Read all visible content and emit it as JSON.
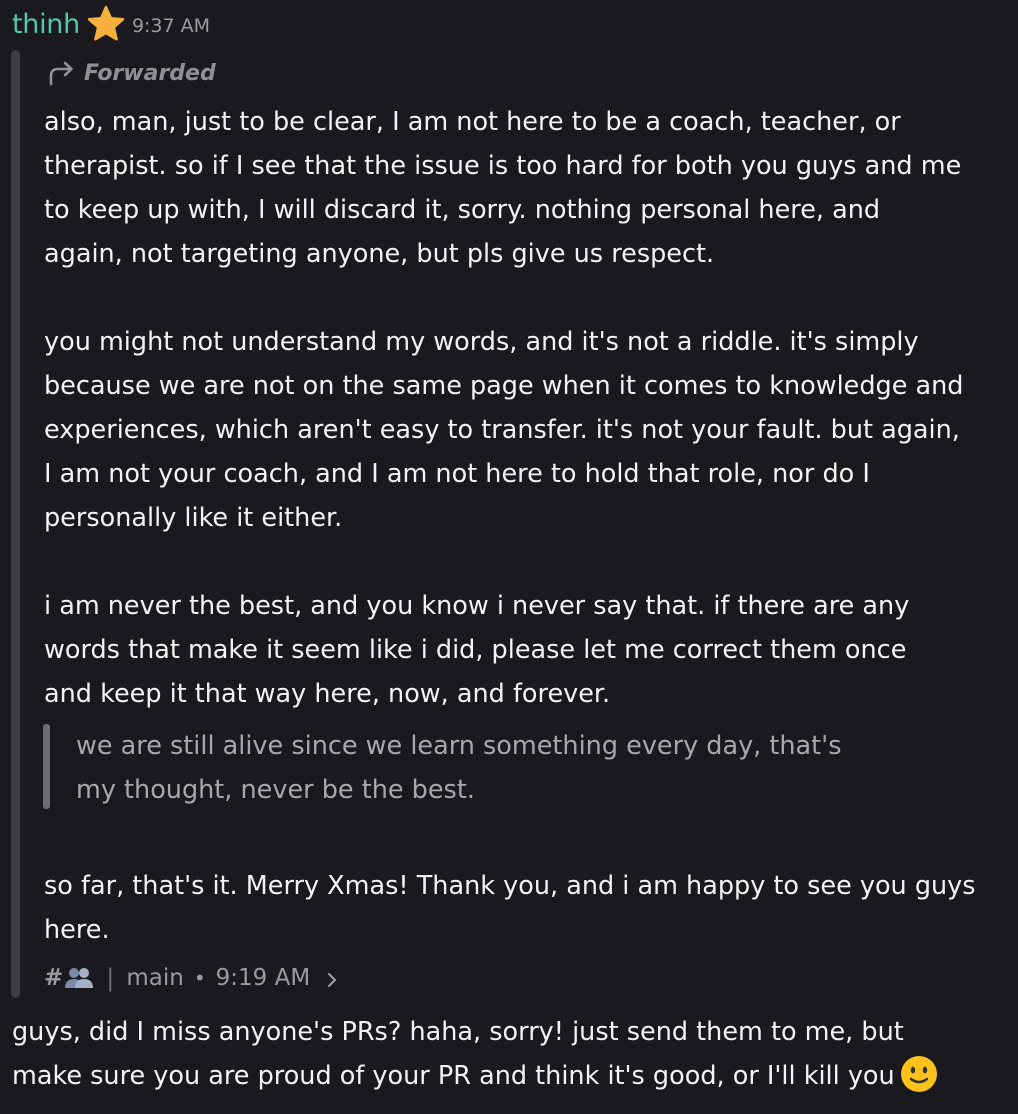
{
  "message": {
    "username": "thinh",
    "timestamp": "9:37 AM",
    "badge_icon": "star-icon",
    "forwarded": {
      "label": "Forwarded",
      "paragraphs": [
        {
          "lines": [
            "also, man, just to be clear, I am not here to be a coach, teacher, or",
            "therapist. so if I see that the issue is too hard for both you guys and me",
            "to keep up with, I will discard it, sorry. nothing personal here, and",
            "again, not targeting anyone, but pls give us respect."
          ]
        },
        {
          "lines": [
            "you might not understand my words, and it's not a riddle. it's simply",
            "because we are not on the same page when it comes to knowledge and",
            "experiences, which aren't easy to transfer. it's not your fault. but again,",
            "I am not your coach, and I am not here to hold that role, nor do I",
            "personally like it either."
          ]
        },
        {
          "lines": [
            "i am never the best, and you know i never say that. if there are any",
            "words that make it seem like i did, please let me correct them once",
            "and keep it that way here, now, and forever."
          ]
        }
      ],
      "quote": {
        "lines": [
          "we are still alive since we learn something every day, that's",
          "my thought, never be the best."
        ]
      },
      "closing": {
        "lines": [
          "so far, that's it. Merry Xmas! Thank you, and i am happy to see you guys",
          "here."
        ]
      },
      "footer": {
        "hash": "#",
        "channel_icon": "people-icon",
        "separator": "|",
        "channel": "main",
        "dot": "•",
        "time": "9:19 AM"
      }
    },
    "body": {
      "lines": [
        "guys, did I miss anyone's PRs? haha, sorry! just send them to me, but",
        "make sure you are proud of your PR and think it's good, or I'll kill you"
      ],
      "emoji": "slightly-smiling-face"
    }
  },
  "colors": {
    "background": "#1a1a1e",
    "username": "#56c3b0",
    "text": "#f2f3f5",
    "muted": "#9a9ba1",
    "quote_text": "#a7a8ae",
    "forward_bar": "#3d3e44"
  }
}
